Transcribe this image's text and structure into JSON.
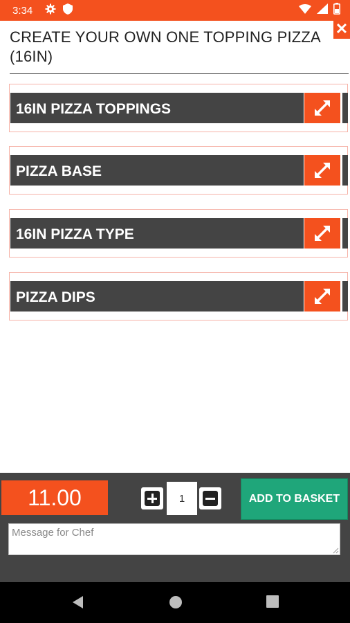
{
  "status_bar": {
    "time": "3:34",
    "icons_left": [
      "gear-icon",
      "shield-icon"
    ],
    "icons_right": [
      "wifi-icon",
      "signal-icon",
      "battery-icon"
    ],
    "background_color": "#f4511e"
  },
  "header": {
    "title": "CREATE YOUR OWN ONE TOPPING PIZZA (16IN)",
    "close_label": "✕"
  },
  "sections": [
    {
      "label": "16IN PIZZA TOPPINGS"
    },
    {
      "label": "PIZZA BASE"
    },
    {
      "label": "16IN PIZZA TYPE"
    },
    {
      "label": "PIZZA DIPS"
    }
  ],
  "footer": {
    "price": "11.00",
    "quantity": "1",
    "add_to_basket_label": "ADD TO BASKET",
    "chef_message_placeholder": "Message for Chef",
    "chef_message_value": ""
  },
  "colors": {
    "accent": "#f4511e",
    "dark_bar": "#444444",
    "basket_button": "#1fa67a"
  },
  "nav_bar": {
    "icons": [
      "back-icon",
      "home-icon",
      "recents-icon"
    ]
  }
}
